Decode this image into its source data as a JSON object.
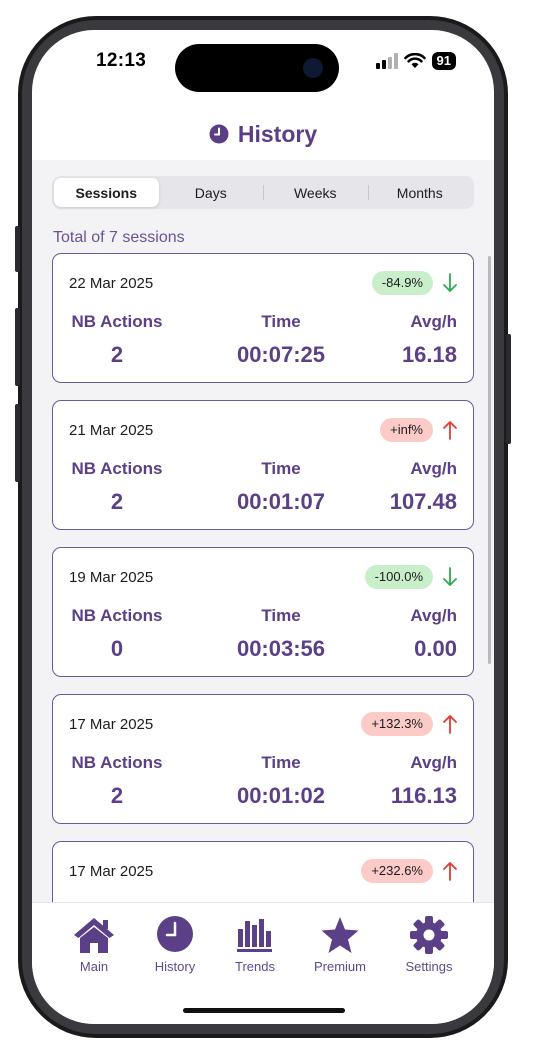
{
  "status_bar": {
    "time": "12:13",
    "battery": "91"
  },
  "header": {
    "title": "History",
    "icon": "clock-icon"
  },
  "segments": {
    "items": [
      "Sessions",
      "Days",
      "Weeks",
      "Months"
    ],
    "selected": "Sessions"
  },
  "summary": {
    "total_text": "Total of 7 sessions"
  },
  "labels": {
    "actions": "NB Actions",
    "time": "Time",
    "rate": "Avg/h"
  },
  "sessions": [
    {
      "date": "22 Mar 2025",
      "change": "-84.9%",
      "trend": "down",
      "actions": "2",
      "time": "00:07:25",
      "rate": "16.18"
    },
    {
      "date": "21 Mar 2025",
      "change": "+inf%",
      "trend": "up",
      "actions": "2",
      "time": "00:01:07",
      "rate": "107.48"
    },
    {
      "date": "19 Mar 2025",
      "change": "-100.0%",
      "trend": "down",
      "actions": "0",
      "time": "00:03:56",
      "rate": "0.00"
    },
    {
      "date": "17 Mar 2025",
      "change": "+132.3%",
      "trend": "up",
      "actions": "2",
      "time": "00:01:02",
      "rate": "116.13"
    },
    {
      "date": "17 Mar 2025",
      "change": "+232.6%",
      "trend": "up",
      "actions": "",
      "time": "",
      "rate": ""
    }
  ],
  "tabbar": [
    {
      "label": "Main",
      "icon": "house-icon"
    },
    {
      "label": "History",
      "icon": "clock-icon"
    },
    {
      "label": "Trends",
      "icon": "bar-chart-icon"
    },
    {
      "label": "Premium",
      "icon": "star-icon"
    },
    {
      "label": "Settings",
      "icon": "gear-icon"
    }
  ],
  "colors": {
    "accent": "#5b4088",
    "trend_up": "#e53935",
    "trend_down": "#2fa84f",
    "badge_up": "#fccbc7",
    "badge_down": "#c8efc9"
  }
}
